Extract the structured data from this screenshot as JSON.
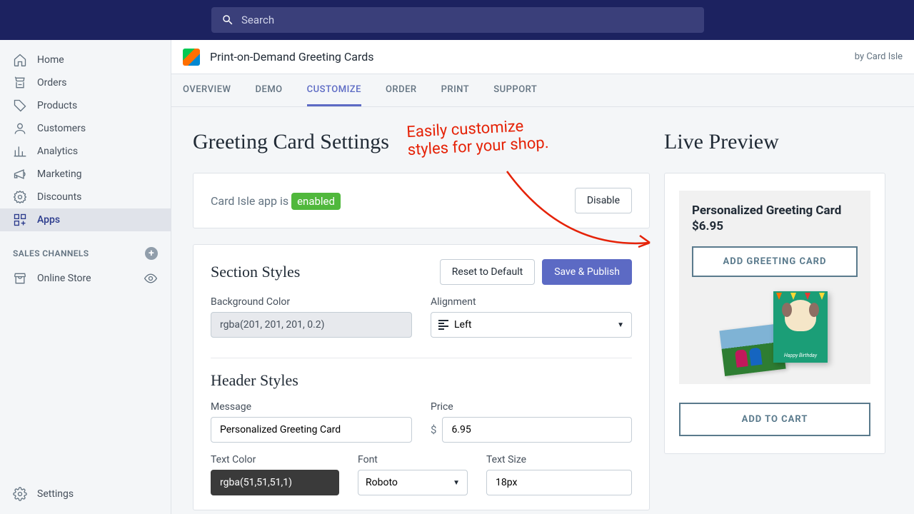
{
  "search": {
    "placeholder": "Search"
  },
  "sidebar": {
    "items": [
      {
        "label": "Home",
        "icon": "home"
      },
      {
        "label": "Orders",
        "icon": "orders"
      },
      {
        "label": "Products",
        "icon": "products"
      },
      {
        "label": "Customers",
        "icon": "customers"
      },
      {
        "label": "Analytics",
        "icon": "analytics"
      },
      {
        "label": "Marketing",
        "icon": "marketing"
      },
      {
        "label": "Discounts",
        "icon": "discounts"
      },
      {
        "label": "Apps",
        "icon": "apps"
      }
    ],
    "channels_label": "SALES CHANNELS",
    "channels": [
      {
        "label": "Online Store"
      }
    ],
    "settings_label": "Settings"
  },
  "app": {
    "title": "Print-on-Demand Greeting Cards",
    "by": "by Card Isle"
  },
  "tabs": [
    "OVERVIEW",
    "DEMO",
    "CUSTOMIZE",
    "ORDER",
    "PRINT",
    "SUPPORT"
  ],
  "settings": {
    "heading": "Greeting Card Settings",
    "status_prefix": "Card Isle app is ",
    "badge": "enabled",
    "disable_btn": "Disable",
    "reset_btn": "Reset to Default",
    "save_btn": "Save & Publish",
    "section_styles_title": "Section Styles",
    "bg_label": "Background Color",
    "bg_value": "rgba(201, 201, 201, 0.2)",
    "align_label": "Alignment",
    "align_value": "Left",
    "header_styles_title": "Header Styles",
    "message_label": "Message",
    "message_value": "Personalized Greeting Card",
    "price_label": "Price",
    "price_value": "6.95",
    "textcolor_label": "Text Color",
    "textcolor_value": "rgba(51,51,51,1)",
    "font_label": "Font",
    "font_value": "Roboto",
    "textsize_label": "Text Size",
    "textsize_value": "18px"
  },
  "preview": {
    "heading": "Live Preview",
    "product_title": "Personalized Greeting Card",
    "product_price": "$6.95",
    "add_card_btn": "ADD GREETING CARD",
    "add_cart_btn": "ADD TO CART",
    "birthday_label": "Happy Birthday"
  },
  "annotation": {
    "line1": "Easily customize",
    "line2": "styles for your shop."
  }
}
